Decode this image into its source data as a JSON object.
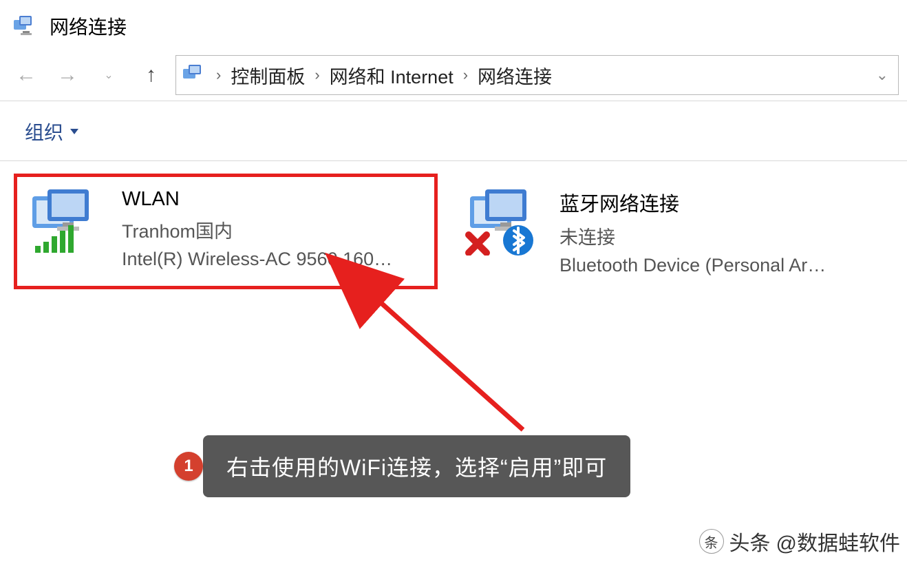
{
  "titlebar": {
    "title": "网络连接"
  },
  "nav": {
    "breadcrumbs": {
      "a": "控制面板",
      "b": "网络和 Internet",
      "c": "网络连接"
    }
  },
  "toolbar": {
    "organize": "组织"
  },
  "connections": [
    {
      "name": "WLAN",
      "sub": "Tranhom国内",
      "dev": "Intel(R) Wireless-AC 9560 160…",
      "status": "connected"
    },
    {
      "name": "蓝牙网络连接",
      "sub": "未连接",
      "dev": "Bluetooth Device (Personal Ar…",
      "status": "disconnected"
    }
  ],
  "annotation": {
    "number": "1",
    "text": "右击使用的WiFi连接，选择“启用”即可"
  },
  "watermark": {
    "label": "头条",
    "author": "@数据蛙软件"
  }
}
